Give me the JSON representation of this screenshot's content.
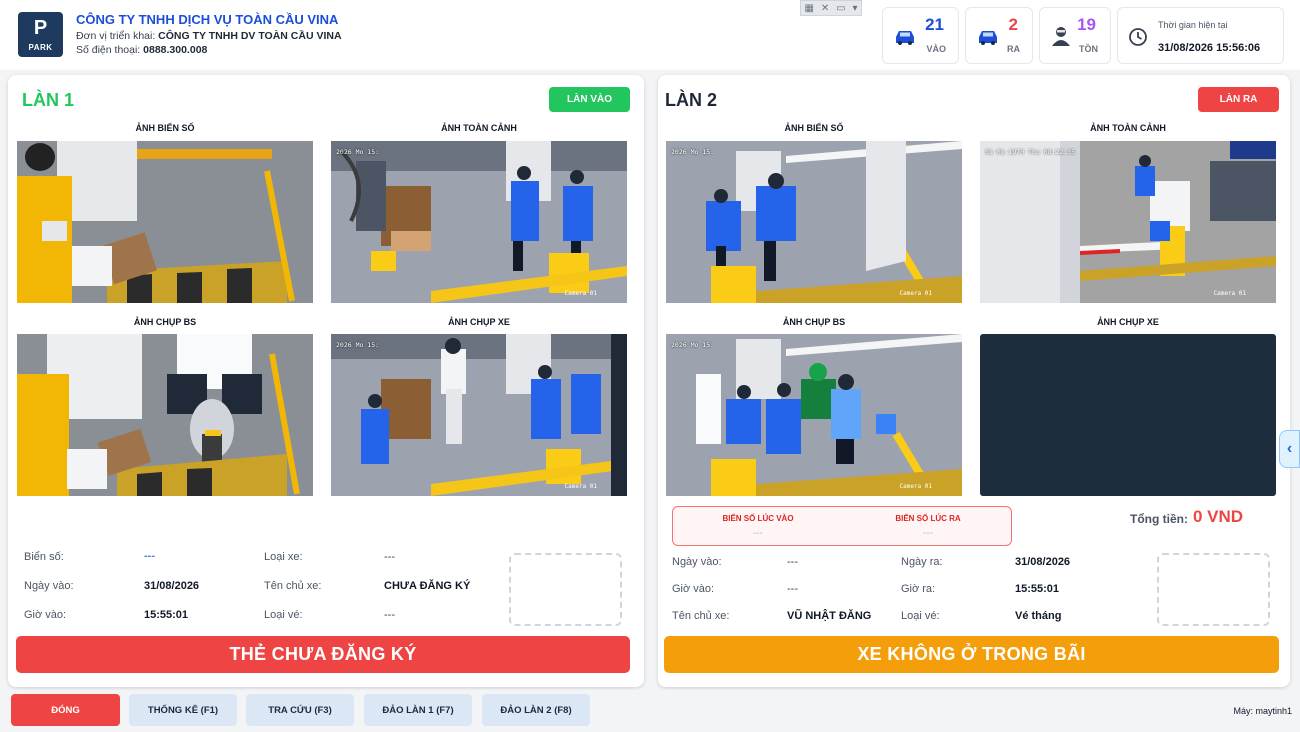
{
  "header": {
    "logo_letter": "P",
    "logo_text": "PARK",
    "company_name": "CÔNG TY TNHH DỊCH VỤ TOÀN CẦU VINA",
    "unit_label": "Đơn vị triển khai:",
    "unit_value": "CÔNG TY TNHH DV TOÀN CẦU VINA",
    "phone_label": "Số điện thoại:",
    "phone_value": "0888.300.008",
    "stats": {
      "in_count": "21",
      "in_label": "VÀO",
      "out_count": "2",
      "out_label": "RA",
      "remain_count": "19",
      "remain_label": "TỒN"
    },
    "time_label": "Thời gian hiện tại",
    "time_value": "31/08/2026 15:56:06"
  },
  "colors": {
    "green": "#22c55e",
    "red": "#ef4444",
    "orange": "#f59e0b",
    "blue": "#1d4ed8",
    "purple": "#a855f7"
  },
  "lane1": {
    "title": "LÀN 1",
    "badge": "LÀN VÀO",
    "cam_labels": [
      "ẢNH BIỂN SỐ",
      "ẢNH TOÀN CẢNH",
      "ẢNH CHỤP BS",
      "ẢNH CHỤP XE"
    ],
    "fields": {
      "plate_label": "Biển số:",
      "plate_value": "---",
      "vehicle_type_label": "Loại xe:",
      "vehicle_type_value": "---",
      "date_in_label": "Ngày vào:",
      "date_in_value": "31/08/2026",
      "owner_label": "Tên chủ xe:",
      "owner_value": "CHƯA ĐĂNG KÝ",
      "time_in_label": "Giờ vào:",
      "time_in_value": "15:55:01",
      "ticket_label": "Loại vé:",
      "ticket_value": "---"
    },
    "status": "THẺ CHƯA ĐĂNG KÝ"
  },
  "lane2": {
    "title": "LÀN 2",
    "badge": "LÀN RA",
    "cam_labels": [
      "ẢNH BIỂN SỐ",
      "ẢNH TOÀN CẢNH",
      "ẢNH CHỤP BS",
      "ẢNH CHỤP XE"
    ],
    "plate_in_label": "BIỂN SỐ LÚC VÀO",
    "plate_in_value": "---",
    "plate_out_label": "BIỂN SỐ LÚC RA",
    "plate_out_value": "---",
    "total_label": "Tổng tiền:",
    "total_value": "0 VND",
    "fields": {
      "date_in_label": "Ngày vào:",
      "date_in_value": "---",
      "date_out_label": "Ngày ra:",
      "date_out_value": "31/08/2026",
      "time_in_label": "Giờ vào:",
      "time_in_value": "---",
      "time_out_label": "Giờ ra:",
      "time_out_value": "15:55:01",
      "owner_label": "Tên chủ xe:",
      "owner_value": "VŨ NHẬT ĐĂNG",
      "ticket_label": "Loại vé:",
      "ticket_value": "Vé tháng"
    },
    "status": "XE KHÔNG Ở TRONG BÃI"
  },
  "camera_stamps": {
    "lane1_overview": "2026 Mo 15:",
    "lane1_vehicle": "2026 Mo 15:",
    "lane2_plate": "2026 Mo 15:",
    "lane2_overview": "01-01-1970 Thu 08:22:35",
    "lane2_platecap": "2026 Mo 15:",
    "camera_tag": "Camera 01"
  },
  "footer": {
    "close": "ĐÓNG",
    "stats": "THỐNG KÊ (F1)",
    "lookup": "TRA CỨU (F3)",
    "swap1": "ĐẢO LÀN 1 (F7)",
    "swap2": "ĐẢO LÀN 2 (F8)",
    "machine": "Máy: maytinh1"
  }
}
